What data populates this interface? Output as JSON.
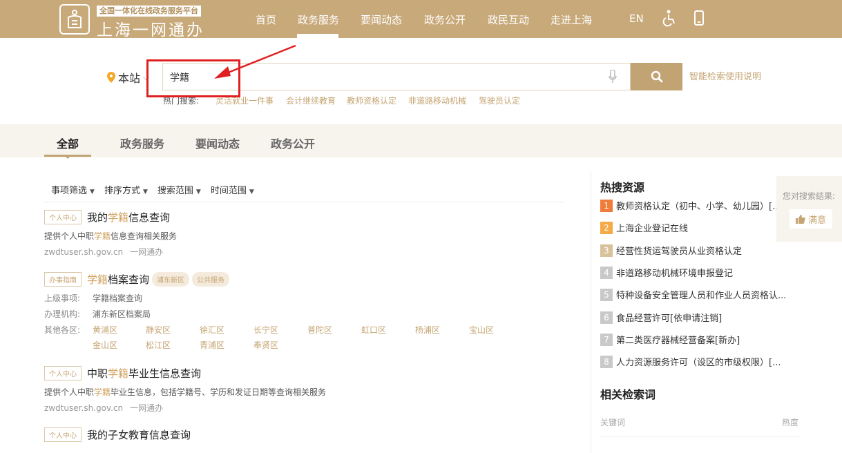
{
  "colors": {
    "brand_gold": "#c8a97a",
    "link_gold": "#c5a471",
    "highlight": "#d0a25f",
    "annotation_red": "#e02020"
  },
  "header": {
    "platform_tag": "全国一体化在线政务服务平台",
    "site_title": "上海一网通办",
    "nav": [
      "首页",
      "政务服务",
      "要闻动态",
      "政务公开",
      "政民互动",
      "走进上海"
    ],
    "nav_active": "政务服务",
    "lang_label": "EN",
    "icons": [
      "logo-emblem-icon",
      "accessibility-icon",
      "mobile-phone-icon"
    ]
  },
  "search": {
    "scope_label": "本站",
    "query": "学籍",
    "help_link": "智能检索使用说明",
    "hot_label": "热门搜索:",
    "hot_terms": [
      "灵活就业一件事",
      "会计继续教育",
      "教师资格认定",
      "非道路移动机械",
      "驾驶员认定"
    ]
  },
  "tabs": [
    "全部",
    "政务服务",
    "要闻动态",
    "政务公开"
  ],
  "filters": [
    "事项筛选",
    "排序方式",
    "搜索范围",
    "时间范围"
  ],
  "results": [
    {
      "badge": "个人中心",
      "title_pre": "我的",
      "title_hl": "学籍",
      "title_post": "信息查询",
      "desc_pre": "提供个人中职",
      "desc_hl": "学籍",
      "desc_post": "信息查询相关服务",
      "domain": "zwdtuser.sh.gov.cn",
      "source": "一网通办"
    },
    {
      "badge": "办事指南",
      "title_hl": "学籍",
      "title_post": "档案查询",
      "pills": [
        "浦东新区",
        "公共服务"
      ],
      "parent_label": "上级事项:",
      "parent_value": "学籍档案查询",
      "org_label": "办理机构:",
      "org_value": "浦东新区档案局",
      "other_label": "其他各区:",
      "districts": [
        "黄浦区",
        "静安区",
        "徐汇区",
        "长宁区",
        "普陀区",
        "虹口区",
        "杨浦区",
        "宝山区",
        "金山区",
        "松江区",
        "青浦区",
        "奉贤区"
      ]
    },
    {
      "badge": "个人中心",
      "title_pre": "中职",
      "title_hl": "学籍",
      "title_post": "毕业生信息查询",
      "desc_pre": "提供个人中职",
      "desc_hl": "学籍",
      "desc_post": "毕业生信息，包括学籍号、学历和发证日期等查询相关服务",
      "domain": "zwdtuser.sh.gov.cn",
      "source": "一网通办"
    },
    {
      "badge": "个人中心",
      "title_pre": "我的子女教育信息查询"
    }
  ],
  "sidebar": {
    "hot_title": "热搜资源",
    "hot_items": [
      {
        "rank": "1",
        "text": "教师资格认定（初中、小学、幼儿园）[..."
      },
      {
        "rank": "2",
        "text": "上海企业登记在线"
      },
      {
        "rank": "3",
        "text": "经营性货运驾驶员从业资格认定"
      },
      {
        "rank": "4",
        "text": "非道路移动机械环境申报登记"
      },
      {
        "rank": "5",
        "text": "特种设备安全管理人员和作业人员资格认..."
      },
      {
        "rank": "6",
        "text": "食品经营许可[依申请注销]"
      },
      {
        "rank": "7",
        "text": "第二类医疗器械经营备案[新办]"
      },
      {
        "rank": "8",
        "text": "人力资源服务许可（设区的市级权限）[..."
      }
    ],
    "rank_colors": [
      "#f07c3c",
      "#f5a947",
      "#d9c19c",
      "#c9c9c9"
    ],
    "related_title": "相关检索词",
    "kw_col": "关键词",
    "heat_col": "热度"
  },
  "feedback": {
    "question": "您对搜索结果:",
    "button": "满意"
  }
}
